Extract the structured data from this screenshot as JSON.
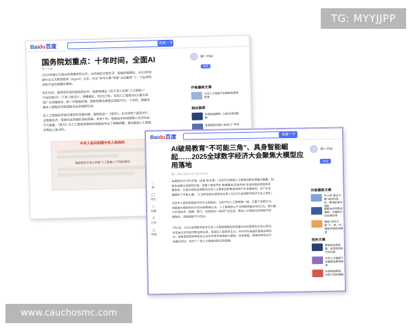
{
  "watermark": {
    "tg": "TG: MYYJJPP",
    "url": "www.cauchosmc.com"
  },
  "screenshot1": {
    "logo_pre": "Bai",
    "logo_du": "du",
    "logo_post": "百度",
    "search_button": "百度一下",
    "title": "国务院划重点：十年时间，全面AI",
    "meta": "新一代AI",
    "paragraphs": [
      [
        "2024年被认为是AI应用爆发的元年，AI开始在日常生活、智能终端落地，2025年则",
        "被行业认为是智能体（Agent）元年，AI从“听令行事”到能“主动服务”了，行业即将",
        "迎来产品的规模化落地。"
      ],
      [
        "8月26日，国务院印发的国务院文件，国务院提出《关于深入实施“人工智能+”",
        "行动的意见》（下称《意见》），明确提出，到2027年，实现人工智能与6大重点领",
        "域广泛深度融合，新一代智能终端、智能体等应用普及率超70%，十年后，我国全",
        "面步入智能经济和智能社会发展新阶段。"
      ],
      [
        "在人工智能技术迭代演进的关键时期，国务院这一《意见》，充分体现了国家对行",
        "业智能经济、智能社会发展的深刻洞察。未来十年，智能技术将深度融入经济社会",
        "方方面面，《意见》对人工智能发展目标和路径作出了明确部署，推动我国人工智能",
        "应用迈上新台阶。"
      ]
    ],
    "strip_head": "中华人民共和国中央人民政府",
    "strip_caption": "国务院关于深入实施“人工智能+”行动的意见",
    "author": "新一代AI",
    "follow": "关注",
    "sections": [
      "作者最新文章",
      "相关推荐"
    ]
  },
  "screenshot2": {
    "logo_pre": "Bai",
    "logo_du": "du",
    "logo_post": "百度",
    "search_button": "百度一下",
    "title_lines": [
      "AI破局教育“不可能三角”、具身智能崛",
      "起……2025全球数字经济大会聚焦大模型应",
      "用落地"
    ],
    "meta": "新一代AI  2025-07-04 10:55",
    "rail": [
      "赞",
      "评论",
      "收藏",
      "分享",
      "举报"
    ],
    "paragraphs": [
      [
        "未来网北京7月4日电（记者 张冰清）“北京作为我国人工智能创新资源最为聚集、创",
        "新生态最为活跃的区域，创建了首家专利·数据基础·实验开放·生态培育的全链条完",
        "整体系，已成为具有全球影响力的人工智能创新策源地和产业发展高地，为产业发",
        "展提供了丰富土壤。”工业和信息化部相关负责人在2025全球数字经济大会上表示。"
      ],
      [
        "北京市人民政府副秘书长许心超指出，北京作为人工智能第一城，汇聚了全国35%",
        "的备案大模型和40%的AI独角兽企业，人工智能核心产业规模突破3000亿元。我们着",
        "力打造技术、数据、算力、应用四位一体的产业生态，推动人工智能与实体经济深",
        "度融合，全面赋能千行百业。"
      ],
      [
        "7月3日，2025全球数字经济大会人工智能赋能应用发展论坛在国家会议中心举办。",
        "论坛由北京市经济和信息化局、海淀区人民政府主办，中关村科技园区管委会等协",
        "办，来自高校院所和知名企业的专家学者围绕大模型、具身智能、智能体等前沿方",
        "向展开研讨，发布了一批人工智能创新应用成果。"
      ]
    ],
    "author": "新一代AI",
    "follow": "关注",
    "sections": [
      "作者最新文章",
      "相关文章"
    ],
    "recs": [
      "中小学“登记卡确”进学科体系，教育部发布通知",
      "破解AI应用落地难题，大模型行业加速应用",
      "智能“百花齐放”下，新一代智能终端迎来爆发",
      "智能体加速发展，应用渗透各行业场景",
      "北京人工智能产业集群发展再提速",
      "科技赋能教育，AI助力因材施教",
      "具身智能机器人走进工厂车间"
    ]
  }
}
